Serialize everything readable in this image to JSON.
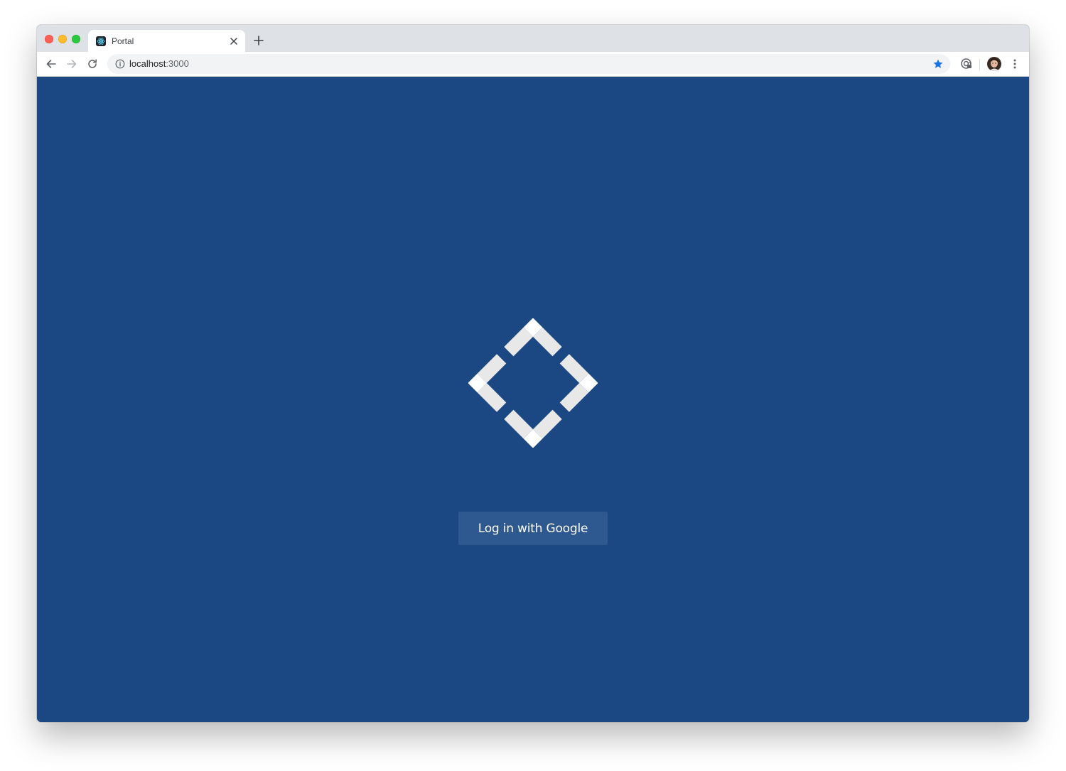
{
  "browser": {
    "tab": {
      "title": "Portal",
      "favicon": "react-atom-icon"
    },
    "new_tab_symbol": "+",
    "address": {
      "host": "localhost",
      "port": ":3000"
    },
    "icons": {
      "back": "arrow-left-icon",
      "forward": "arrow-right-icon",
      "reload": "reload-icon",
      "info": "info-icon",
      "bookmark": "star-icon",
      "extension": "password-manager-extension-icon",
      "profile": "avatar",
      "menu": "kebab-menu-icon"
    }
  },
  "page": {
    "logo": "portal-logo",
    "login_button_label": "Log in with Google"
  },
  "colors": {
    "page_background": "#1b4883",
    "button_background": "#2d5890",
    "logo_color": "#e8e8e8",
    "bookmark_star": "#1a73e8"
  }
}
